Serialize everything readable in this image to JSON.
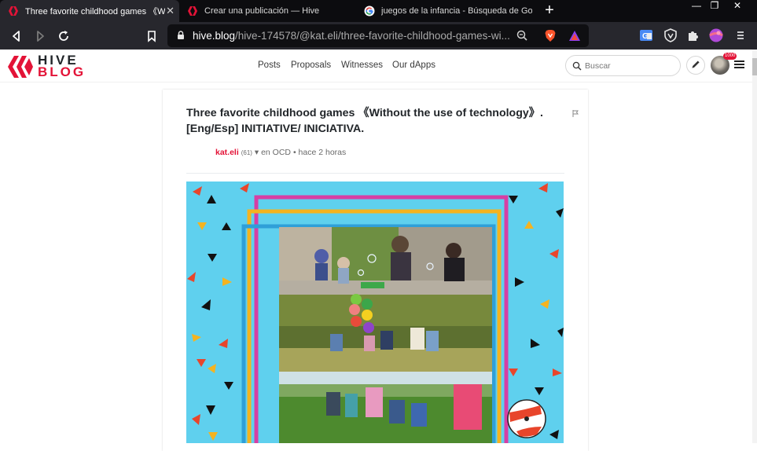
{
  "browser": {
    "tabs": [
      {
        "title": "Three favorite childhood games 《Wit",
        "active": true
      },
      {
        "title": "Crear una publicación — Hive",
        "active": false
      },
      {
        "title": "juegos de la infancia - Búsqueda de Goog",
        "active": false
      }
    ],
    "url_host": "hive.blog",
    "url_path": "/hive-174578/@kat.eli/three-favorite-childhood-games-wi..."
  },
  "hive": {
    "logo_line1": "HIVE",
    "logo_line2": "BLOG",
    "nav": [
      "Posts",
      "Proposals",
      "Witnesses",
      "Our dApps"
    ],
    "search_placeholder": "Buscar",
    "notifications": "1000"
  },
  "post": {
    "title": "Three favorite childhood games 《Without the use of technology》. [Eng/Esp] INITIATIVE/ INICIATIVA.",
    "author": "kat.eli",
    "reputation": "(61)",
    "community_prefix": "en",
    "community": "OCD",
    "time": "hace 2 horas"
  },
  "colors": {
    "brand_red": "#e31337",
    "image_bg": "#5fd0ee"
  }
}
